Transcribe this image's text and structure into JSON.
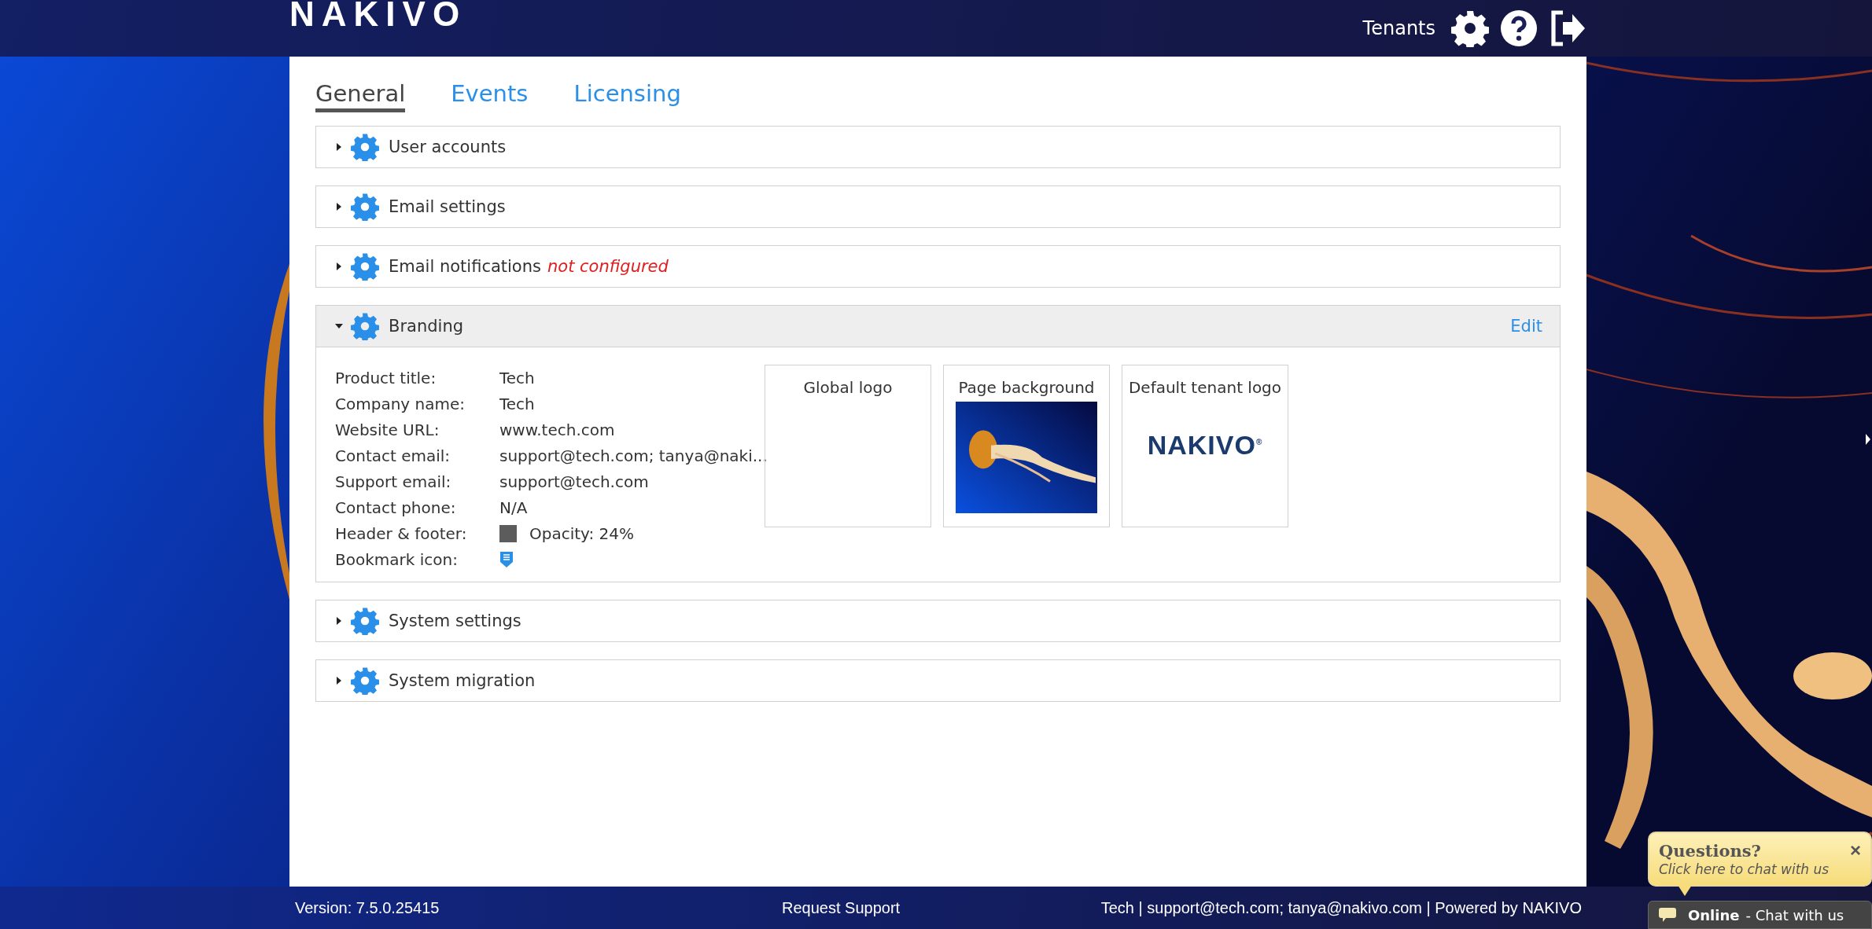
{
  "header": {
    "logo": "NAKIVO",
    "tenants": "Tenants"
  },
  "tabs": [
    {
      "label": "General",
      "selected": true
    },
    {
      "label": "Events",
      "selected": false
    },
    {
      "label": "Licensing",
      "selected": false
    }
  ],
  "sections": [
    {
      "title": "User accounts",
      "expanded": false
    },
    {
      "title": "Email settings",
      "expanded": false
    },
    {
      "title": "Email notifications",
      "note": "not configured",
      "expanded": false
    },
    {
      "title": "Branding",
      "expanded": true,
      "action": "Edit",
      "fields": [
        {
          "kind": "text",
          "label": "Product title:",
          "value": "Tech"
        },
        {
          "kind": "text",
          "label": "Company name:",
          "value": "Tech"
        },
        {
          "kind": "text",
          "label": "Website URL:",
          "value": "www.tech.com"
        },
        {
          "kind": "text",
          "label": "Contact email:",
          "value": "support@tech.com; tanya@naki..."
        },
        {
          "kind": "text",
          "label": "Support email:",
          "value": "support@tech.com"
        },
        {
          "kind": "text",
          "label": "Contact phone:",
          "value": "N/A"
        },
        {
          "kind": "swatch",
          "label": "Header & footer:",
          "color": "#5c5c5c",
          "value": "Opacity: 24%"
        },
        {
          "kind": "icon",
          "label": "Bookmark icon:"
        }
      ],
      "previews": [
        {
          "kind": "empty",
          "title": "Global logo"
        },
        {
          "kind": "picture",
          "title": "Page background"
        },
        {
          "kind": "logo",
          "title": "Default tenant logo",
          "logo": "NAKIVO$^{®}$"
        }
      ]
    },
    {
      "title": "System settings",
      "expanded": false
    },
    {
      "title": "System migration",
      "expanded": false
    }
  ],
  "footer": {
    "version": "Version: 7.5.0.25415",
    "support": "Request Support",
    "contact": "Tech | support@tech.com; tanya@nakivo.com | Powered by NAKIVO"
  },
  "chat": {
    "title": "Questions?",
    "close": "×",
    "prompt": "Click here to chat with us",
    "status": "Online",
    "label": "- Chat with us"
  }
}
